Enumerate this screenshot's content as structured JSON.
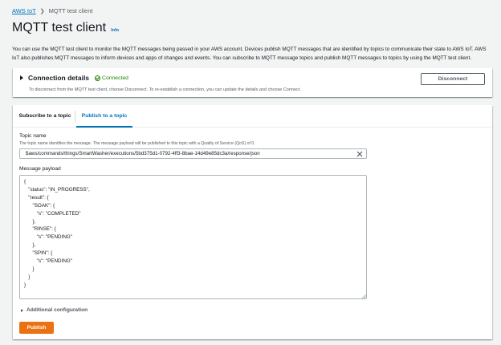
{
  "breadcrumb": {
    "root": "AWS IoT",
    "current": "MQTT test client"
  },
  "page": {
    "title": "MQTT test client",
    "info_link": "Info",
    "description": "You can use the MQTT test client to monitor the MQTT messages being passed in your AWS account. Devices publish MQTT messages that are identified by topics to communicate their state to AWS IoT. AWS IoT also publishes MQTT messages to inform devices and apps of changes and events. You can subscribe to MQTT message topics and publish MQTT messages to topics by using the MQTT test client."
  },
  "connection": {
    "title": "Connection details",
    "status": "Connected",
    "help": "To disconnect from the MQTT test client, choose Disconnect. To re-establish a connection, you can update the details and choose Connect.",
    "disconnect_label": "Disconnect"
  },
  "tabs": [
    {
      "label": "Subscribe to a topic",
      "active": false
    },
    {
      "label": "Publish to a topic",
      "active": true
    }
  ],
  "publish": {
    "topic_label": "Topic name",
    "topic_desc": "The topic name identifies the message. The message payload will be published to this topic with a Quality of Service (QoS) of 0.",
    "topic_value": "$aws/commands/things/SmartWasher/executions/5bd375d1-0792-4ff3-8bae-14d49e85dc3a/response/json",
    "payload_label": "Message payload",
    "payload_value": "{\n   \"status\": \"IN_PROGRESS\",\n   \"result\": {\n      \"SOAK\": {\n         \"s\": \"COMPLETED\"\n      },\n      \"RINSE\": {\n         \"s\": \"PENDING\"\n      },\n      \"SPIN\": {\n         \"s\": \"PENDING\"\n      }\n   }\n}",
    "additional_config": "Additional configuration",
    "publish_label": "Publish"
  },
  "colors": {
    "link": "#0073bb",
    "success": "#1d8102",
    "primary_button": "#ec7211",
    "background": "#f2f3f3"
  }
}
